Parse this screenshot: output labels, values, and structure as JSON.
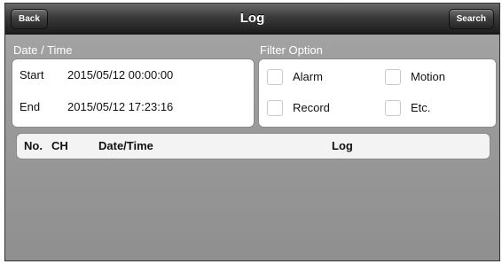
{
  "nav": {
    "back_label": "Back",
    "title": "Log",
    "search_label": "Search"
  },
  "datetime": {
    "section_label": "Date / Time",
    "start_label": "Start",
    "start_value": "2015/05/12 00:00:00",
    "end_label": "End",
    "end_value": "2015/05/12 17:23:16"
  },
  "filter": {
    "section_label": "Filter Option",
    "options": [
      {
        "label": "Alarm",
        "checked": false
      },
      {
        "label": "Motion",
        "checked": false
      },
      {
        "label": "Record",
        "checked": false
      },
      {
        "label": "Etc.",
        "checked": false
      }
    ]
  },
  "table": {
    "columns": [
      "No.",
      "CH",
      "Date/Time",
      "Log"
    ],
    "rows": []
  },
  "colors": {
    "navbar": "#2a2a2a",
    "background": "#9b9b9b",
    "panel": "#ffffff"
  }
}
